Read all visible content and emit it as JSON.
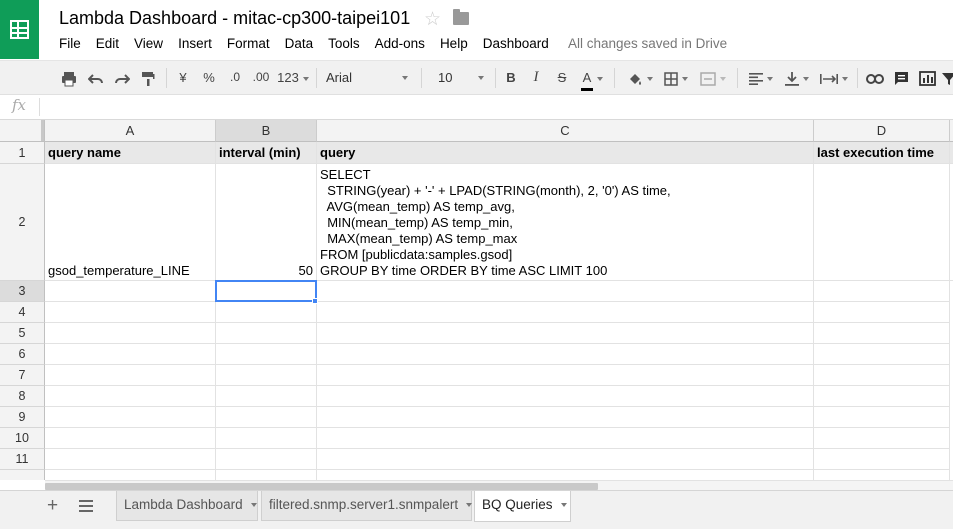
{
  "app": {
    "title": "Lambda Dashboard - mitac-cp300-taipei101",
    "save_status": "All changes saved in Drive",
    "icons": {
      "logo": "sheets-logo-icon",
      "star": "star-icon",
      "folder": "folder-icon"
    }
  },
  "menu": [
    "File",
    "Edit",
    "View",
    "Insert",
    "Format",
    "Data",
    "Tools",
    "Add-ons",
    "Help",
    "Dashboard"
  ],
  "toolbar": {
    "currency": "¥",
    "percent": "%",
    "decrease_decimals": ".0",
    "increase_decimals": ".00",
    "more_formats": "123",
    "font": "Arial",
    "font_size": "10",
    "bold": "B",
    "italic": "I",
    "strikethrough": "S",
    "text_color": "A",
    "text_color_value": "#000000"
  },
  "formula_bar": {
    "icon": "fx",
    "value": ""
  },
  "grid": {
    "columns": [
      "A",
      "B",
      "C",
      "D"
    ],
    "rows": [
      "1",
      "2",
      "3",
      "4",
      "5",
      "6",
      "7",
      "8",
      "9",
      "10",
      "11"
    ],
    "header": {
      "query_name": "query name",
      "interval": "interval (min)",
      "query": "query",
      "last_execution": "last execution time"
    },
    "data_row": {
      "query_name": "gsod_temperature_LINE",
      "interval": "50",
      "query": "SELECT\n  STRING(year) + '-' + LPAD(STRING(month), 2, '0') AS time,\n  AVG(mean_temp) AS temp_avg,\n  MIN(mean_temp) AS temp_min,\n  MAX(mean_temp) AS temp_max\nFROM [publicdata:samples.gsod]\nGROUP BY time ORDER BY time ASC LIMIT 100",
      "last_execution": ""
    },
    "selection": "B3",
    "accent_color": "#4285f4"
  },
  "sheets": {
    "tabs": [
      "Lambda Dashboard",
      "filtered.snmp.server1.snmpalert",
      "BQ Queries"
    ],
    "active": "BQ Queries"
  },
  "colors": {
    "brand": "#0f9d58",
    "selection": "#4285f4"
  }
}
